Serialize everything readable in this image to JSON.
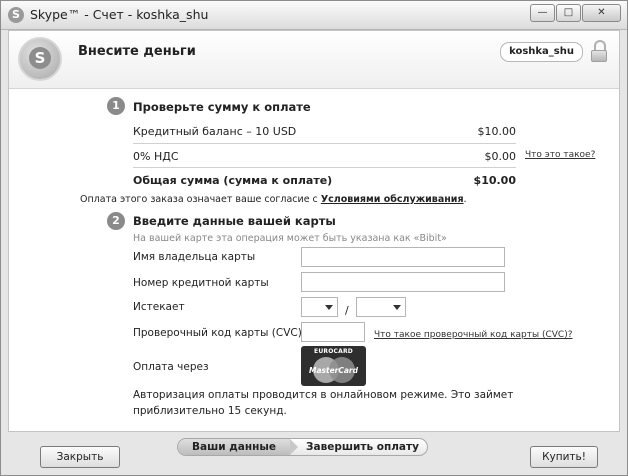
{
  "window": {
    "title": "Skype™ - Счет - koshka_shu",
    "minimize_label": "—",
    "maximize_label": "□",
    "close_label": "✕",
    "icon_text": "S"
  },
  "header": {
    "title": "Внесите деньги",
    "username": "koshka_shu",
    "logo_text": "S"
  },
  "section1": {
    "number": "1",
    "title": "Проверьте сумму к оплате",
    "rows": [
      {
        "label": "Кредитный баланс – 10 USD",
        "amount": "$10.00"
      },
      {
        "label": "0% НДС",
        "amount": "$0.00",
        "link": "Что это такое?"
      }
    ],
    "total_label": "Общая сумма (сумма к оплате)",
    "total_amount": "$10.00"
  },
  "consent": {
    "text": "Оплата этого заказа означает ваше согласие с",
    "link": "Условиями обслуживания",
    "end": "."
  },
  "section2": {
    "number": "2",
    "title": "Введите данные вашей карты",
    "hint": "На вашей карте эта операция может быть указана как «Bibit»",
    "fields": {
      "cardholder_label": "Имя владельца карты",
      "card_number_label": "Номер кредитной карты",
      "expires_label": "Истекает",
      "cvc_label": "Проверочный код карты (CVC)",
      "cvc_link": "Что такое проверочный код карты (CVC)?",
      "pay_via_label": "Оплата через"
    },
    "card_brand_top": "EUROCARD",
    "card_brand_name": "MasterCard",
    "expires_separator": "/",
    "auth_note": "Авторизация оплаты проводится в онлайновом режиме. Это займет приблизительно 15 секунд."
  },
  "footer": {
    "close_button": "Закрыть",
    "buy_button": "Купить!",
    "progress_steps": [
      "Ваши данные",
      "Завершить оплату"
    ]
  }
}
